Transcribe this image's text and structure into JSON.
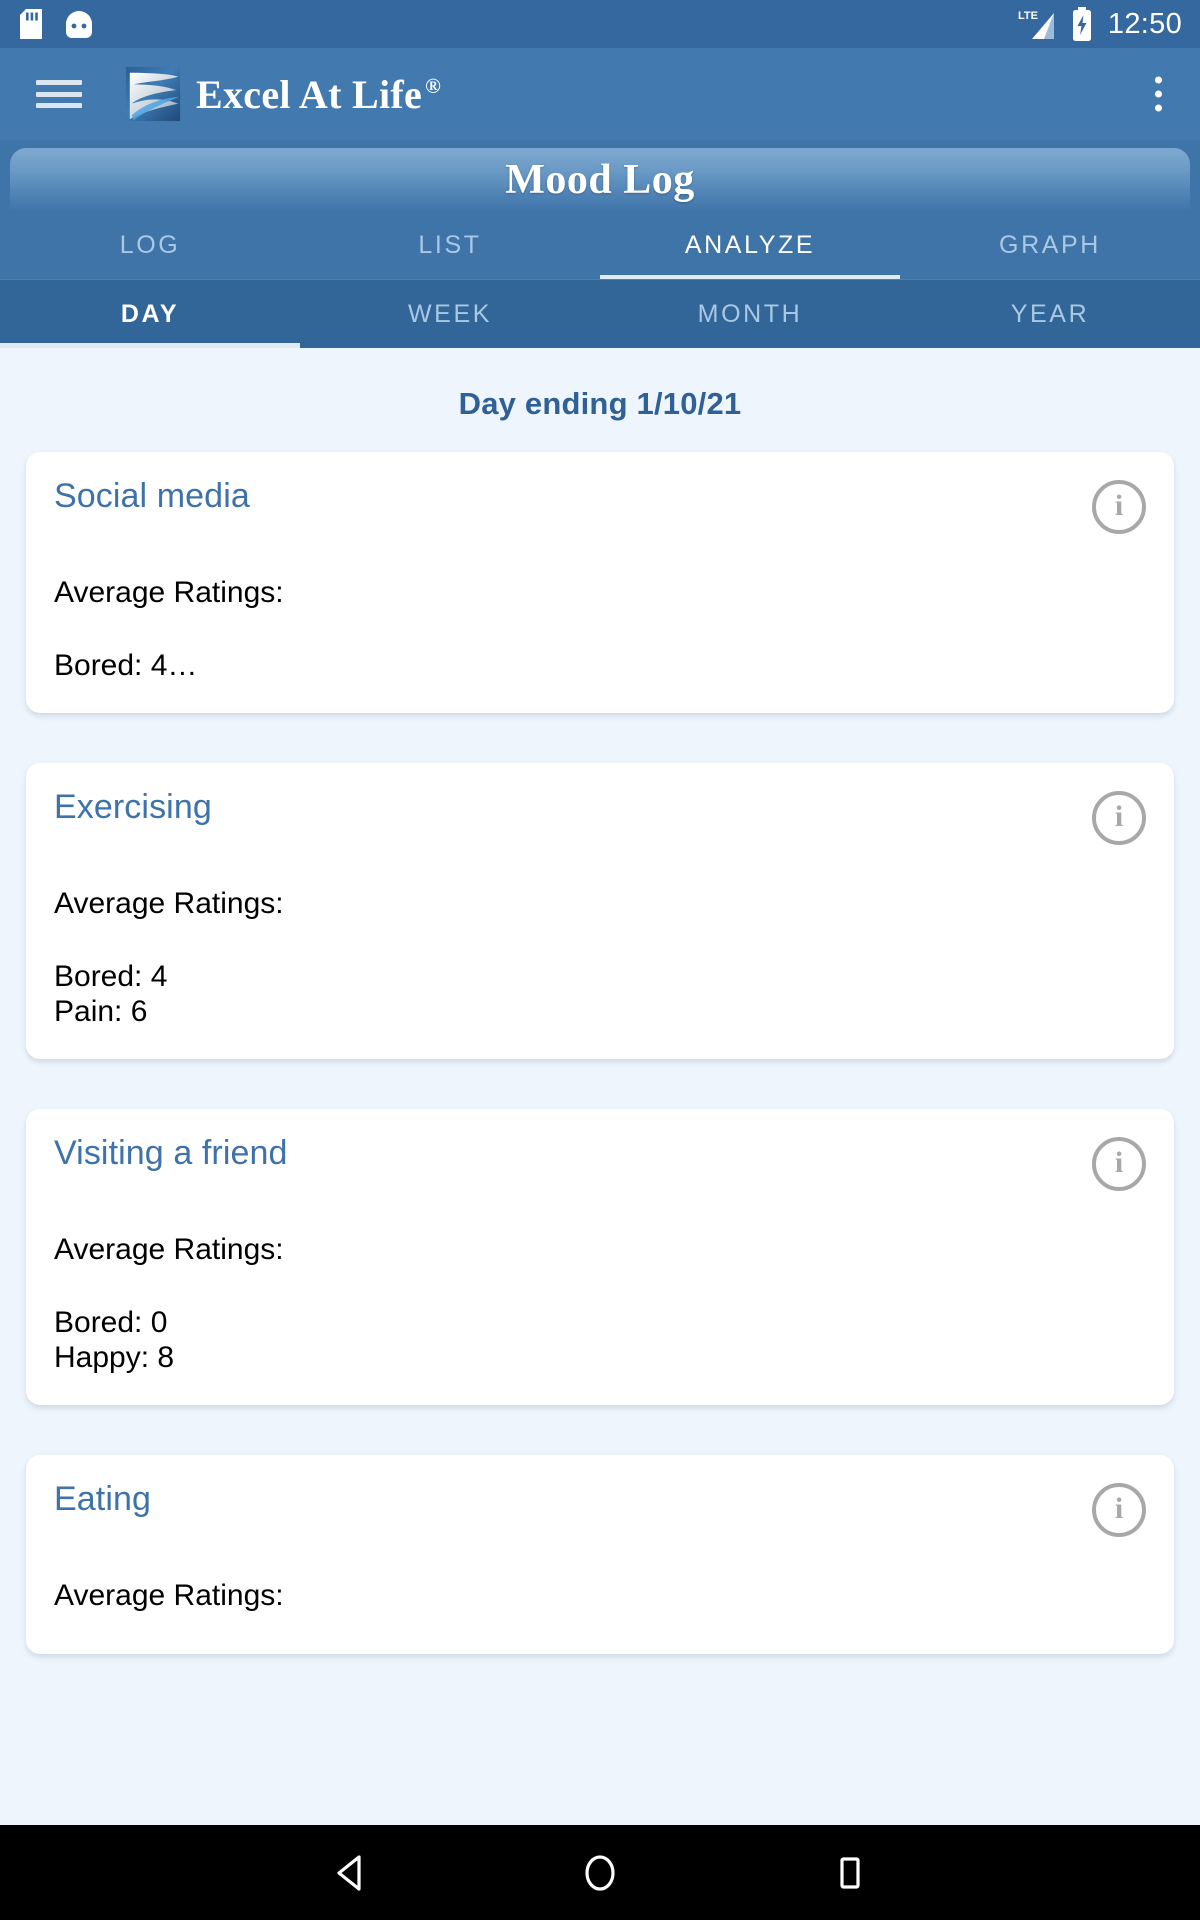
{
  "status_bar": {
    "icons": [
      "sd-card-icon",
      "android-head-icon"
    ],
    "network": "LTE",
    "battery": "charging",
    "time": "12:50"
  },
  "app_bar": {
    "menu_icon": "hamburger-menu-icon",
    "logo": "excel-at-life-logo",
    "title": "Excel At Life",
    "registered_mark": "®",
    "overflow_icon": "overflow-menu-icon"
  },
  "banner": {
    "title": "Mood Log"
  },
  "primary_tabs": {
    "items": [
      {
        "label": "LOG",
        "active": false
      },
      {
        "label": "LIST",
        "active": false
      },
      {
        "label": "ANALYZE",
        "active": true
      },
      {
        "label": "GRAPH",
        "active": false
      }
    ]
  },
  "secondary_tabs": {
    "items": [
      {
        "label": "DAY",
        "active": true
      },
      {
        "label": "WEEK",
        "active": false
      },
      {
        "label": "MONTH",
        "active": false
      },
      {
        "label": "YEAR",
        "active": false
      }
    ]
  },
  "content": {
    "date_heading": "Day ending 1/10/21",
    "cards": [
      {
        "title": "Social media",
        "subtitle": "Average Ratings:",
        "ratings": [
          "Bored: 4…"
        ],
        "info_icon": "info-icon",
        "truncated": true
      },
      {
        "title": "Exercising",
        "subtitle": "Average Ratings:",
        "ratings": [
          "Bored: 4",
          "Pain: 6"
        ],
        "info_icon": "info-icon",
        "truncated": false
      },
      {
        "title": "Visiting a friend",
        "subtitle": "Average Ratings:",
        "ratings": [
          "Bored: 0",
          "Happy: 8"
        ],
        "info_icon": "info-icon",
        "truncated": false
      },
      {
        "title": "Eating",
        "subtitle": "Average Ratings:",
        "ratings": [],
        "info_icon": "info-icon",
        "truncated": false
      }
    ]
  },
  "nav_bar": {
    "back": "back-triangle-icon",
    "home": "home-circle-icon",
    "recents": "recents-square-icon"
  },
  "colors": {
    "status_bar_bg": "#35689e",
    "app_bar_bg": "#4279ae",
    "tab_bar_bg": "#3f74a9",
    "sub_tab_bg": "#326699",
    "page_bg": "#eef5fd",
    "accent_text": "#2f6196",
    "card_title": "#3d72aa"
  }
}
